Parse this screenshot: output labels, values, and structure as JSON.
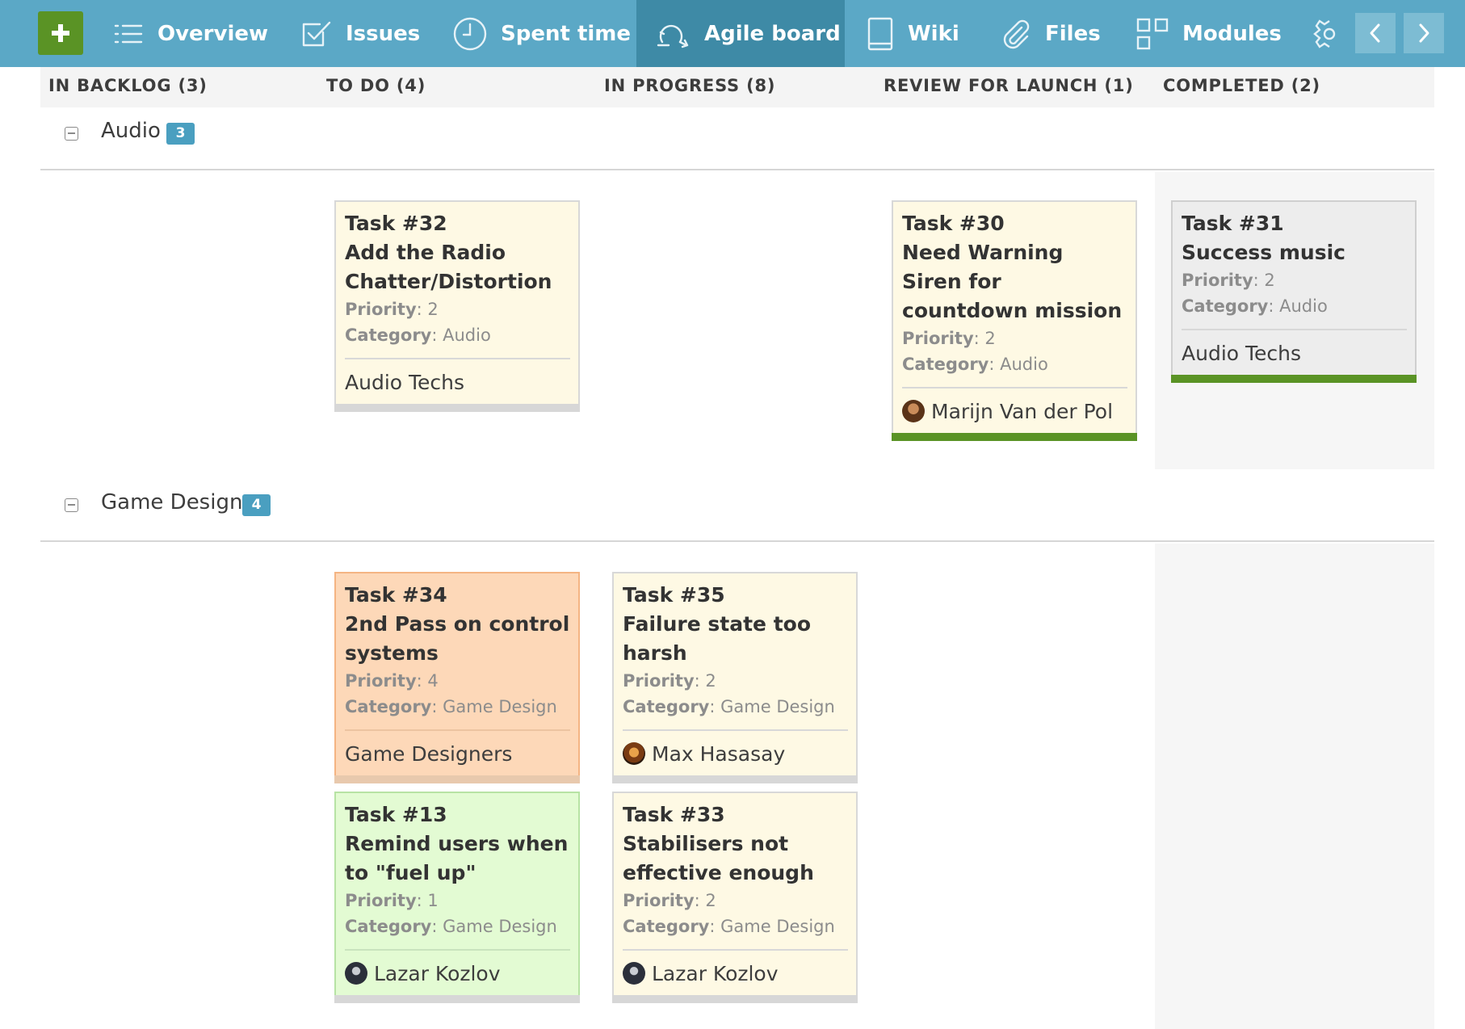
{
  "nav": {
    "tabs": [
      {
        "label": "Overview",
        "icon": "list-icon"
      },
      {
        "label": "Issues",
        "icon": "checkbox-icon"
      },
      {
        "label": "Spent time",
        "icon": "clock-icon"
      },
      {
        "label": "Agile board",
        "icon": "agile-cycle-icon",
        "active": true
      },
      {
        "label": "Wiki",
        "icon": "book-icon"
      },
      {
        "label": "Files",
        "icon": "paperclip-icon"
      },
      {
        "label": "Modules",
        "icon": "modules-icon"
      }
    ],
    "colors": {
      "bar": "#5ba8c6",
      "active": "#3e8aa6",
      "add_button": "#5a9325"
    }
  },
  "columns": [
    {
      "label": "IN BACKLOG (3)"
    },
    {
      "label": "TO DO (4)"
    },
    {
      "label": "IN PROGRESS (8)"
    },
    {
      "label": "REVIEW FOR LAUNCH (1)"
    },
    {
      "label": "COMPLETED (2)"
    }
  ],
  "lanes": [
    {
      "name": "Audio",
      "count": "3",
      "cards": [
        {
          "id": "Task #32",
          "title": "Add the Radio Chatter/Distortion",
          "priority_label": "Priority",
          "priority": ": 2",
          "category_label": "Category",
          "category": ": Audio",
          "assignee": "Audio Techs",
          "column": "TO DO"
        },
        {
          "id": "Task #30",
          "title": "Need Warning Siren for countdown mission",
          "priority_label": "Priority",
          "priority": ": 2",
          "category_label": "Category",
          "category": ": Audio",
          "assignee": "Marijn Van der Pol",
          "column": "REVIEW FOR LAUNCH"
        },
        {
          "id": "Task #31",
          "title": "Success music",
          "priority_label": "Priority",
          "priority": ": 2",
          "category_label": "Category",
          "category": ": Audio",
          "assignee": "Audio Techs",
          "column": "COMPLETED"
        }
      ]
    },
    {
      "name": "Game Design",
      "count": "4",
      "cards": [
        {
          "id": "Task #34",
          "title": "2nd Pass on control systems",
          "priority_label": "Priority",
          "priority": ": 4",
          "category_label": "Category",
          "category": ": Game Design",
          "assignee": "Game Designers",
          "column": "TO DO"
        },
        {
          "id": "Task #35",
          "title": "Failure state too harsh",
          "priority_label": "Priority",
          "priority": ": 2",
          "category_label": "Category",
          "category": ": Game Design",
          "assignee": "Max Hasasay",
          "column": "IN PROGRESS"
        },
        {
          "id": "Task #13",
          "title": "Remind users when to \"fuel up\"",
          "priority_label": "Priority",
          "priority": ": 1",
          "category_label": "Category",
          "category": ": Game Design",
          "assignee": "Lazar Kozlov",
          "column": "TO DO"
        },
        {
          "id": "Task #33",
          "title": "Stabilisers not effective enough",
          "priority_label": "Priority",
          "priority": ": 2",
          "category_label": "Category",
          "category": ": Game Design",
          "assignee": "Lazar Kozlov",
          "column": "IN PROGRESS"
        }
      ]
    }
  ],
  "card_colors": {
    "default": "#fef9e4",
    "high_priority": "#fdd8b8",
    "low_priority": "#e3fbd3",
    "closed": "#ededed",
    "done_bar": "#5a9325"
  }
}
